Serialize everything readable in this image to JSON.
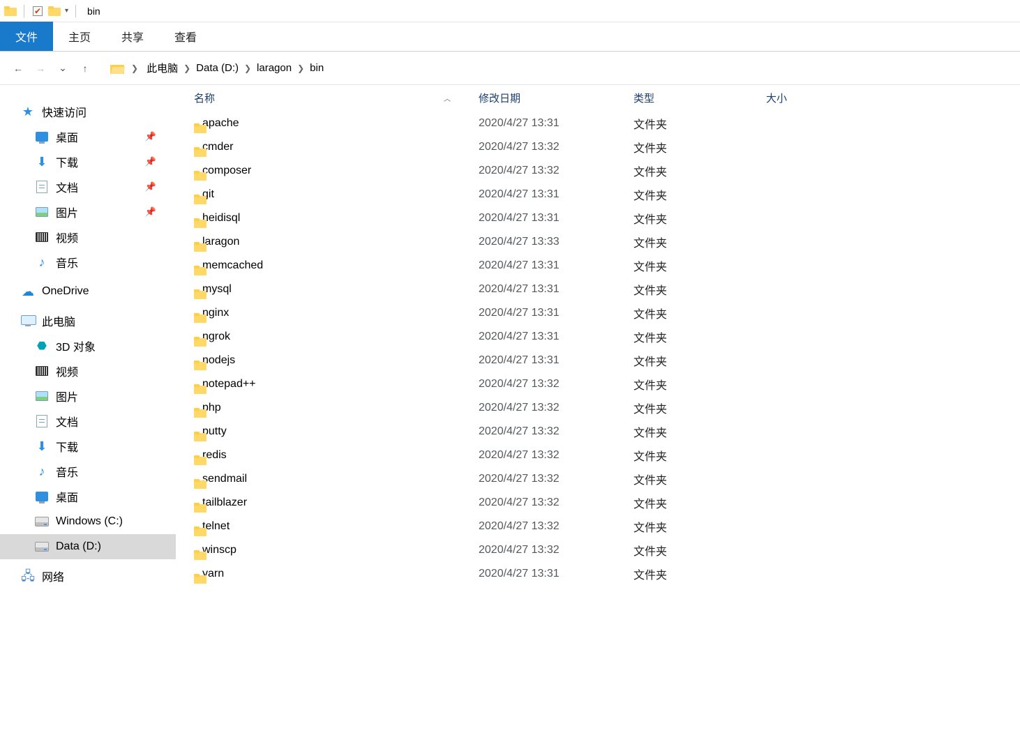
{
  "window": {
    "title": "bin"
  },
  "ribbon": {
    "file": "文件",
    "tabs": [
      "主页",
      "共享",
      "查看"
    ]
  },
  "breadcrumb": [
    "此电脑",
    "Data (D:)",
    "laragon",
    "bin"
  ],
  "columns": {
    "name": "名称",
    "date": "修改日期",
    "type": "类型",
    "size": "大小"
  },
  "sidebar": {
    "quick": {
      "label": "快速访问",
      "items": [
        {
          "label": "桌面",
          "icon": "desktop",
          "pinned": true
        },
        {
          "label": "下载",
          "icon": "download",
          "pinned": true
        },
        {
          "label": "文档",
          "icon": "doc",
          "pinned": true
        },
        {
          "label": "图片",
          "icon": "pic",
          "pinned": true
        },
        {
          "label": "视频",
          "icon": "vid",
          "pinned": false
        },
        {
          "label": "音乐",
          "icon": "mus",
          "pinned": false
        }
      ]
    },
    "onedrive": {
      "label": "OneDrive"
    },
    "thispc": {
      "label": "此电脑",
      "items": [
        {
          "label": "3D 对象",
          "icon": "cube"
        },
        {
          "label": "视频",
          "icon": "vid"
        },
        {
          "label": "图片",
          "icon": "pic"
        },
        {
          "label": "文档",
          "icon": "doc"
        },
        {
          "label": "下载",
          "icon": "download"
        },
        {
          "label": "音乐",
          "icon": "mus"
        },
        {
          "label": "桌面",
          "icon": "desktop"
        },
        {
          "label": "Windows (C:)",
          "icon": "disk"
        },
        {
          "label": "Data (D:)",
          "icon": "disk",
          "selected": true
        }
      ]
    },
    "network": {
      "label": "网络"
    }
  },
  "files": [
    {
      "name": "apache",
      "date": "2020/4/27 13:31",
      "type": "文件夹"
    },
    {
      "name": "cmder",
      "date": "2020/4/27 13:32",
      "type": "文件夹"
    },
    {
      "name": "composer",
      "date": "2020/4/27 13:32",
      "type": "文件夹"
    },
    {
      "name": "git",
      "date": "2020/4/27 13:31",
      "type": "文件夹"
    },
    {
      "name": "heidisql",
      "date": "2020/4/27 13:31",
      "type": "文件夹"
    },
    {
      "name": "laragon",
      "date": "2020/4/27 13:33",
      "type": "文件夹"
    },
    {
      "name": "memcached",
      "date": "2020/4/27 13:31",
      "type": "文件夹"
    },
    {
      "name": "mysql",
      "date": "2020/4/27 13:31",
      "type": "文件夹"
    },
    {
      "name": "nginx",
      "date": "2020/4/27 13:31",
      "type": "文件夹"
    },
    {
      "name": "ngrok",
      "date": "2020/4/27 13:31",
      "type": "文件夹"
    },
    {
      "name": "nodejs",
      "date": "2020/4/27 13:31",
      "type": "文件夹"
    },
    {
      "name": "notepad++",
      "date": "2020/4/27 13:32",
      "type": "文件夹"
    },
    {
      "name": "php",
      "date": "2020/4/27 13:32",
      "type": "文件夹"
    },
    {
      "name": "putty",
      "date": "2020/4/27 13:32",
      "type": "文件夹"
    },
    {
      "name": "redis",
      "date": "2020/4/27 13:32",
      "type": "文件夹"
    },
    {
      "name": "sendmail",
      "date": "2020/4/27 13:32",
      "type": "文件夹"
    },
    {
      "name": "tailblazer",
      "date": "2020/4/27 13:32",
      "type": "文件夹"
    },
    {
      "name": "telnet",
      "date": "2020/4/27 13:32",
      "type": "文件夹"
    },
    {
      "name": "winscp",
      "date": "2020/4/27 13:32",
      "type": "文件夹"
    },
    {
      "name": "yarn",
      "date": "2020/4/27 13:31",
      "type": "文件夹"
    }
  ]
}
